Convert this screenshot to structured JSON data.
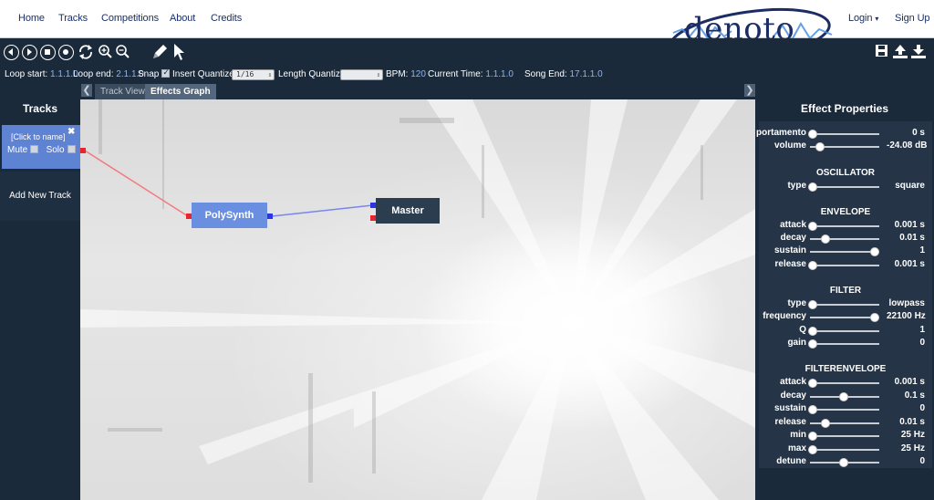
{
  "nav": {
    "links": [
      "Home",
      "Tracks",
      "Competitions",
      "About",
      "Credits"
    ],
    "logo": "denoto",
    "login": "Login",
    "signup": "Sign Up"
  },
  "toolbar": {
    "buttons": [
      "rewind-icon",
      "play-icon",
      "stop-icon",
      "record-icon",
      "loop-icon",
      "zoom-in-icon",
      "zoom-out-icon",
      "pencil-icon",
      "pointer-icon"
    ],
    "right_buttons": [
      "save-icon",
      "upload-icon",
      "download-icon"
    ]
  },
  "status": {
    "loop_start_label": "Loop start:",
    "loop_start": "1.1.1.0",
    "loop_end_label": "Loop end:",
    "loop_end": "2.1.1.0",
    "snap_label": "Snap",
    "snap_checked": true,
    "insert_quantize_label": "Insert Quantize:",
    "insert_quantize": "1/16",
    "length_quantize_label": "Length Quantize:",
    "length_quantize": "",
    "bpm_label": "BPM:",
    "bpm": "120",
    "current_time_label": "Current Time:",
    "current_time": "1.1.1.0",
    "song_end_label": "Song End:",
    "song_end": "17.1.1.0"
  },
  "tabs": [
    "Track View",
    "Effects Graph"
  ],
  "tracks": {
    "title": "Tracks",
    "track_name": "[Click to name]",
    "mute_label": "Mute",
    "solo_label": "Solo",
    "add_label": "Add New Track"
  },
  "graph": {
    "nodes": [
      "PolySynth",
      "Master"
    ]
  },
  "props": {
    "title": "Effect Properties",
    "rows": [
      {
        "label": "portamento",
        "value": "0 s",
        "level": 0.0
      },
      {
        "label": "volume",
        "value": "-24.08 dB",
        "level": 0.12
      }
    ],
    "sections": [
      {
        "title": "OSCILLATOR",
        "rows": [
          {
            "label": "type",
            "value": "square",
            "level": 0.0
          }
        ]
      },
      {
        "title": "ENVELOPE",
        "rows": [
          {
            "label": "attack",
            "value": "0.001 s",
            "level": 0.0
          },
          {
            "label": "decay",
            "value": "0.01 s",
            "level": 0.2
          },
          {
            "label": "sustain",
            "value": "1",
            "level": 1.0
          },
          {
            "label": "release",
            "value": "0.001 s",
            "level": 0.0
          }
        ]
      },
      {
        "title": "FILTER",
        "rows": [
          {
            "label": "type",
            "value": "lowpass",
            "level": 0.0
          },
          {
            "label": "frequency",
            "value": "22100 Hz",
            "level": 1.0
          },
          {
            "label": "Q",
            "value": "1",
            "level": 0.0
          },
          {
            "label": "gain",
            "value": "0",
            "level": 0.0
          }
        ]
      },
      {
        "title": "FILTERENVELOPE",
        "rows": [
          {
            "label": "attack",
            "value": "0.001 s",
            "level": 0.0
          },
          {
            "label": "decay",
            "value": "0.1 s",
            "level": 0.5
          },
          {
            "label": "sustain",
            "value": "0",
            "level": 0.0
          },
          {
            "label": "release",
            "value": "0.01 s",
            "level": 0.2
          },
          {
            "label": "min",
            "value": "25 Hz",
            "level": 0.0
          },
          {
            "label": "max",
            "value": "25 Hz",
            "level": 0.0
          },
          {
            "label": "detune",
            "value": "0",
            "level": 0.5
          }
        ]
      }
    ]
  },
  "colors": {
    "accent": "#5f83d3",
    "nav_text": "#1a2f6a",
    "panel_bg": "#1b2a3b",
    "value_blue": "#8fb4ee",
    "port_red": "#e8242c",
    "port_blue": "#2a35e8"
  }
}
